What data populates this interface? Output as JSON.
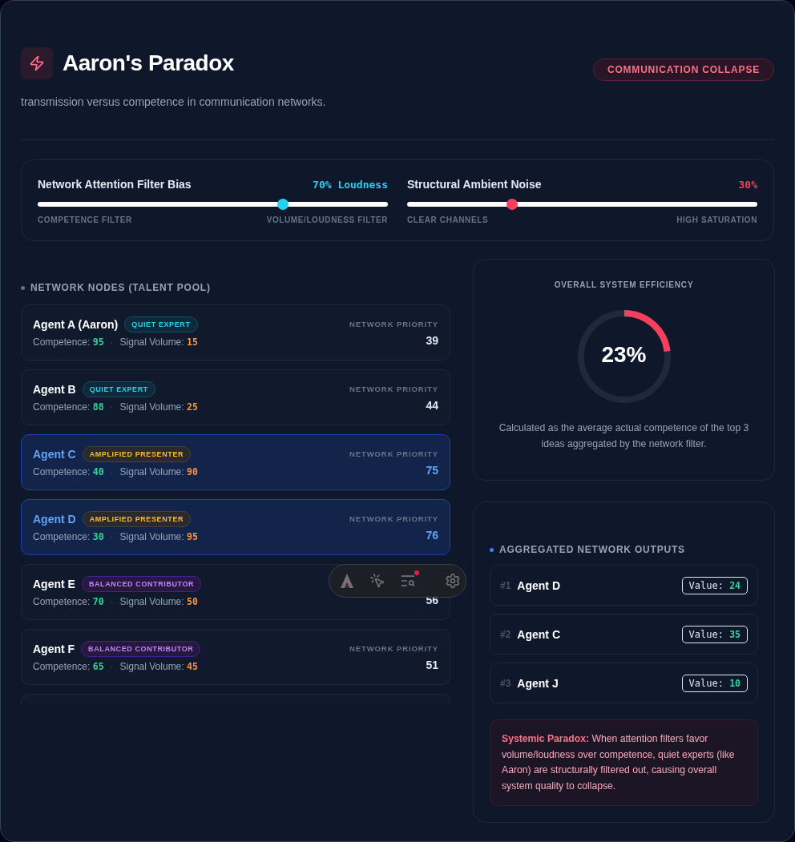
{
  "header": {
    "title": "Aaron's Paradox",
    "subtitle": "transmission versus competence in communication networks.",
    "status_badge": "COMMUNICATION COLLAPSE"
  },
  "controls": [
    {
      "label": "Network Attention Filter Bias",
      "reading": "70% Loudness",
      "level": 0.7,
      "color": "#22d3ee",
      "min_label": "COMPETENCE FILTER",
      "max_label": "VOLUME/LOUDNESS FILTER"
    },
    {
      "label": "Structural Ambient Noise",
      "reading": "30%",
      "level": 0.3,
      "color": "#f43f5e",
      "min_label": "CLEAR CHANNELS",
      "max_label": "HIGH SATURATION"
    }
  ],
  "nodes": {
    "title": "NETWORK NODES (TALENT POOL)",
    "items": [
      {
        "kind": "agent",
        "name": "Agent A (Aaron)",
        "badge": {
          "text": "QUIET EXPERT",
          "kind": "quiet"
        },
        "competence_label": "Competence:",
        "competence": "95",
        "separator": "·",
        "volume_label": "Signal Volume:",
        "volume": "15",
        "priority_label": "NETWORK PRIORITY",
        "priority": "39",
        "highlighted": false
      },
      {
        "kind": "agent",
        "name": "Agent B",
        "badge": {
          "text": "QUIET EXPERT",
          "kind": "quiet"
        },
        "competence_label": "Competence:",
        "competence": "88",
        "separator": "·",
        "volume_label": "Signal Volume:",
        "volume": "25",
        "priority_label": "NETWORK PRIORITY",
        "priority": "44",
        "highlighted": false
      },
      {
        "kind": "agent",
        "name": "Agent C",
        "badge": {
          "text": "AMPLIFIED PRESENTER",
          "kind": "amplified"
        },
        "competence_label": "Competence:",
        "competence": "40",
        "separator": "·",
        "volume_label": "Signal Volume:",
        "volume": "90",
        "priority_label": "NETWORK PRIORITY",
        "priority": "75",
        "highlighted": true
      },
      {
        "kind": "agent",
        "name": "Agent D",
        "badge": {
          "text": "AMPLIFIED PRESENTER",
          "kind": "amplified"
        },
        "competence_label": "Competence:",
        "competence": "30",
        "separator": "·",
        "volume_label": "Signal Volume:",
        "volume": "95",
        "priority_label": "NETWORK PRIORITY",
        "priority": "76",
        "highlighted": true
      },
      {
        "kind": "agent",
        "name": "Agent E",
        "badge": {
          "text": "BALANCED CONTRIBUTOR",
          "kind": "balanced"
        },
        "competence_label": "Competence:",
        "competence": "70",
        "separator": "·",
        "volume_label": "Signal Volume:",
        "volume": "50",
        "priority": "56",
        "highlighted": false
      },
      {
        "kind": "agent",
        "name": "Agent F",
        "badge": {
          "text": "BALANCED CONTRIBUTOR",
          "kind": "balanced"
        },
        "competence_label": "Competence:",
        "competence": "65",
        "separator": "·",
        "volume_label": "Signal Volume:",
        "volume": "45",
        "priority_label": "NETWORK PRIORITY",
        "priority": "51",
        "highlighted": false
      },
      {
        "kind": "cut_off"
      }
    ]
  },
  "efficiency": {
    "title": "OVERALL SYSTEM EFFICIENCY",
    "value": "23%",
    "level": 0.23,
    "note": "Calculated as the average actual competence of the top 3 ideas aggregated by the network filter."
  },
  "outputs": {
    "title": "AGGREGATED NETWORK OUTPUTS",
    "items": [
      {
        "rank": "#1",
        "name": "Agent D",
        "value_label": "Value:",
        "value": "24"
      },
      {
        "rank": "#2",
        "name": "Agent C",
        "value_label": "Value:",
        "value": "35"
      },
      {
        "rank": "#3",
        "name": "Agent J",
        "value_label": "Value:",
        "value": "10"
      }
    ],
    "warning": "**Systemic Paradox:** When attention filters favor volume/loudness over competence, quiet experts (like Aaron) are structurally filtered out, causing overall system quality to collapse."
  },
  "floating_toolbar": {
    "notification": true
  }
}
